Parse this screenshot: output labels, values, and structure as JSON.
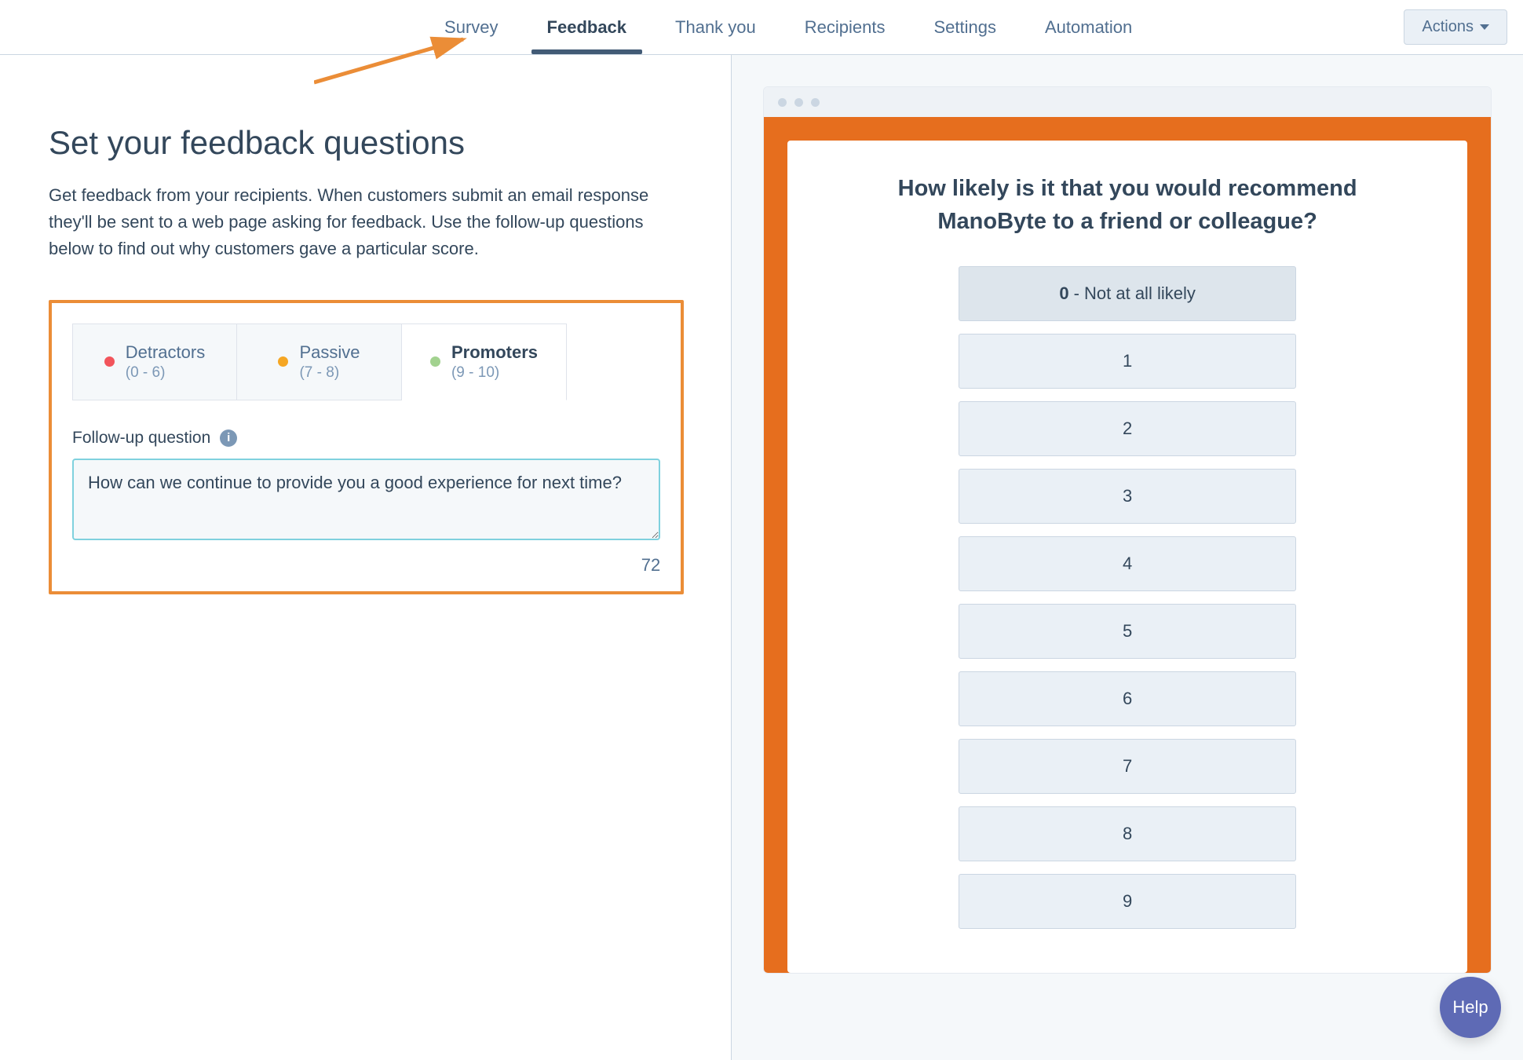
{
  "nav": {
    "tabs": [
      "Survey",
      "Feedback",
      "Thank you",
      "Recipients",
      "Settings",
      "Automation"
    ],
    "active": 1,
    "actions_label": "Actions"
  },
  "left": {
    "heading": "Set your feedback questions",
    "description": "Get feedback from your recipients. When customers submit an email response they'll be sent to a web page asking for feedback. Use the follow-up questions below to find out why customers gave a particular score.",
    "segments": [
      {
        "title": "Detractors",
        "range": "(0 - 6)",
        "dot": "d"
      },
      {
        "title": "Passive",
        "range": "(7 - 8)",
        "dot": "p"
      },
      {
        "title": "Promoters",
        "range": "(9 - 10)",
        "dot": "pr"
      }
    ],
    "active_segment": 2,
    "followup_label": "Follow-up question",
    "followup_value": "How can we continue to provide you a good experience for next time?",
    "char_count": "72"
  },
  "preview": {
    "question": "How likely is it that you would recommend ManoByte to a friend or colleague?",
    "low_label": "Not at all likely",
    "options": [
      "0",
      "1",
      "2",
      "3",
      "4",
      "5",
      "6",
      "7",
      "8",
      "9"
    ],
    "selected": 0
  },
  "help_label": "Help",
  "colors": {
    "accent": "#e66e1e",
    "highlight": "#eb8d37",
    "indigo": "#425b76"
  }
}
